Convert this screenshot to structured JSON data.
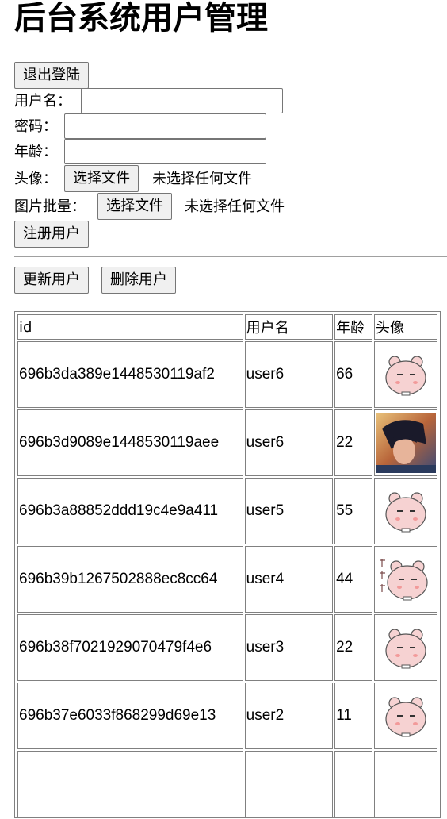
{
  "page": {
    "title": "后台系统用户管理"
  },
  "form": {
    "logout_label": "退出登陆",
    "username_label": "用户名：",
    "password_label": "密码：",
    "age_label": "年龄：",
    "avatar_label": "头像：",
    "batch_label": "图片批量：",
    "choose_file_label": "选择文件",
    "no_file_text": "未选择任何文件",
    "register_label": "注册用户"
  },
  "actions": {
    "update_label": "更新用户",
    "delete_label": "删除用户"
  },
  "table": {
    "headers": [
      "id",
      "用户名",
      "年龄",
      "头像"
    ],
    "rows": [
      {
        "id": "696b3da389e1448530119af2",
        "username": "user6",
        "age": "66",
        "avatar": "cartoon-bear-avatar"
      },
      {
        "id": "696b3d9089e1448530119aee",
        "username": "user6",
        "age": "22",
        "avatar": "photo-portrait-avatar"
      },
      {
        "id": "696b3a88852ddd19c4e9a411",
        "username": "user5",
        "age": "55",
        "avatar": "cartoon-bear-avatar"
      },
      {
        "id": "696b39b1267502888ec8cc64",
        "username": "user4",
        "age": "44",
        "avatar": "cartoon-bear-avatar"
      },
      {
        "id": "696b38f7021929070479f4e6",
        "username": "user3",
        "age": "22",
        "avatar": "cartoon-bear-avatar"
      },
      {
        "id": "696b37e6033f868299d69e13",
        "username": "user2",
        "age": "11",
        "avatar": "cartoon-bear-avatar"
      }
    ]
  },
  "colors": {
    "button_bg": "#f0f0f0",
    "border": "#808080",
    "avatar_bear": "#f6d2d2",
    "avatar_photo": "#2a3a5c"
  }
}
